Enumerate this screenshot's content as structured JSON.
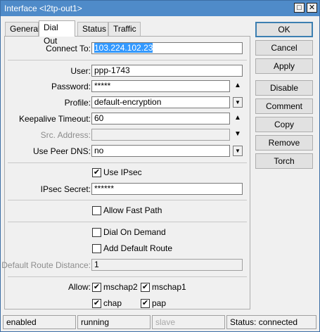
{
  "window": {
    "title": "Interface <l2tp-out1>",
    "restore_glyph": "□",
    "close_glyph": "✕"
  },
  "tabs": [
    "General",
    "Dial Out",
    "Status",
    "Traffic"
  ],
  "form": {
    "connect_to": {
      "label": "Connect To:",
      "value": "103.224.102.23"
    },
    "user": {
      "label": "User:",
      "value": "ppp-1743"
    },
    "password": {
      "label": "Password:",
      "value": "*****"
    },
    "profile": {
      "label": "Profile:",
      "value": "default-encryption"
    },
    "keepalive": {
      "label": "Keepalive Timeout:",
      "value": "60"
    },
    "src_address": {
      "label": "Src. Address:",
      "value": ""
    },
    "use_peer_dns": {
      "label": "Use Peer DNS:",
      "value": "no"
    },
    "use_ipsec": {
      "label": "Use IPsec",
      "checked": true
    },
    "ipsec_secret": {
      "label": "IPsec Secret:",
      "value": "******"
    },
    "allow_fast_path": {
      "label": "Allow Fast Path",
      "checked": false
    },
    "dial_on_demand": {
      "label": "Dial On Demand",
      "checked": false
    },
    "add_default_route": {
      "label": "Add Default Route",
      "checked": false
    },
    "default_route_distance": {
      "label": "Default Route Distance:",
      "value": "1"
    },
    "allow": {
      "label": "Allow:",
      "mschap2": {
        "label": "mschap2",
        "checked": true
      },
      "mschap1": {
        "label": "mschap1",
        "checked": true
      },
      "chap": {
        "label": "chap",
        "checked": true
      },
      "pap": {
        "label": "pap",
        "checked": true
      }
    },
    "glyphs": {
      "up": "▲",
      "down": "▼",
      "dropdown": "▼",
      "check": "✔"
    }
  },
  "buttons": {
    "ok": "OK",
    "cancel": "Cancel",
    "apply": "Apply",
    "disable": "Disable",
    "comment": "Comment",
    "copy": "Copy",
    "remove": "Remove",
    "torch": "Torch"
  },
  "statusbar": {
    "state": "enabled",
    "running": "running",
    "slave": "slave",
    "status": "Status: connected"
  }
}
